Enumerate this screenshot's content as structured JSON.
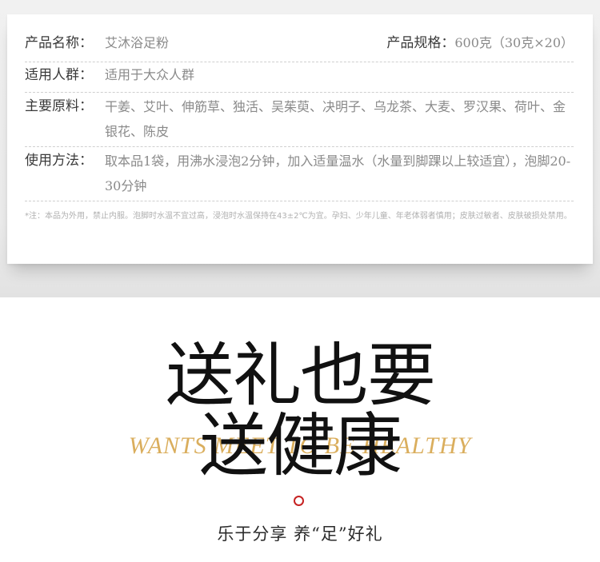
{
  "product": {
    "name_label": "产品名称：",
    "name_value": "艾沐浴足粉",
    "spec_label": "产品规格：",
    "spec_value": "600克（30克×20）",
    "audience_label": "适用人群：",
    "audience_value": "适用于大众人群",
    "ingredients_label": "主要原料：",
    "ingredients_value": "干姜、艾叶、伸筋草、独活、吴茱萸、决明子、乌龙茶、大麦、罗汉果、荷叶、金银花、陈皮",
    "usage_label": "使用方法：",
    "usage_value": "取本品1袋，用沸水浸泡2分钟，加入适量温水（水量到脚踝以上较适宜），泡脚20-30分钟",
    "note": "*注：本品为外用，禁止内服。泡脚时水温不宜过高，浸泡时水温保持在43±2℃为宜。孕妇、少年儿童、年老体弱者慎用；皮肤过敏者、皮肤破损处禁用。"
  },
  "promo": {
    "headline_1": "送礼也要",
    "headline_2": "送健康",
    "english": "WANTS MEET TO BE HEALTHY",
    "tagline": "乐于分享 养“足”好礼"
  },
  "colors": {
    "accent_gold": "#d9aa55",
    "circle_red": "#c62222"
  }
}
